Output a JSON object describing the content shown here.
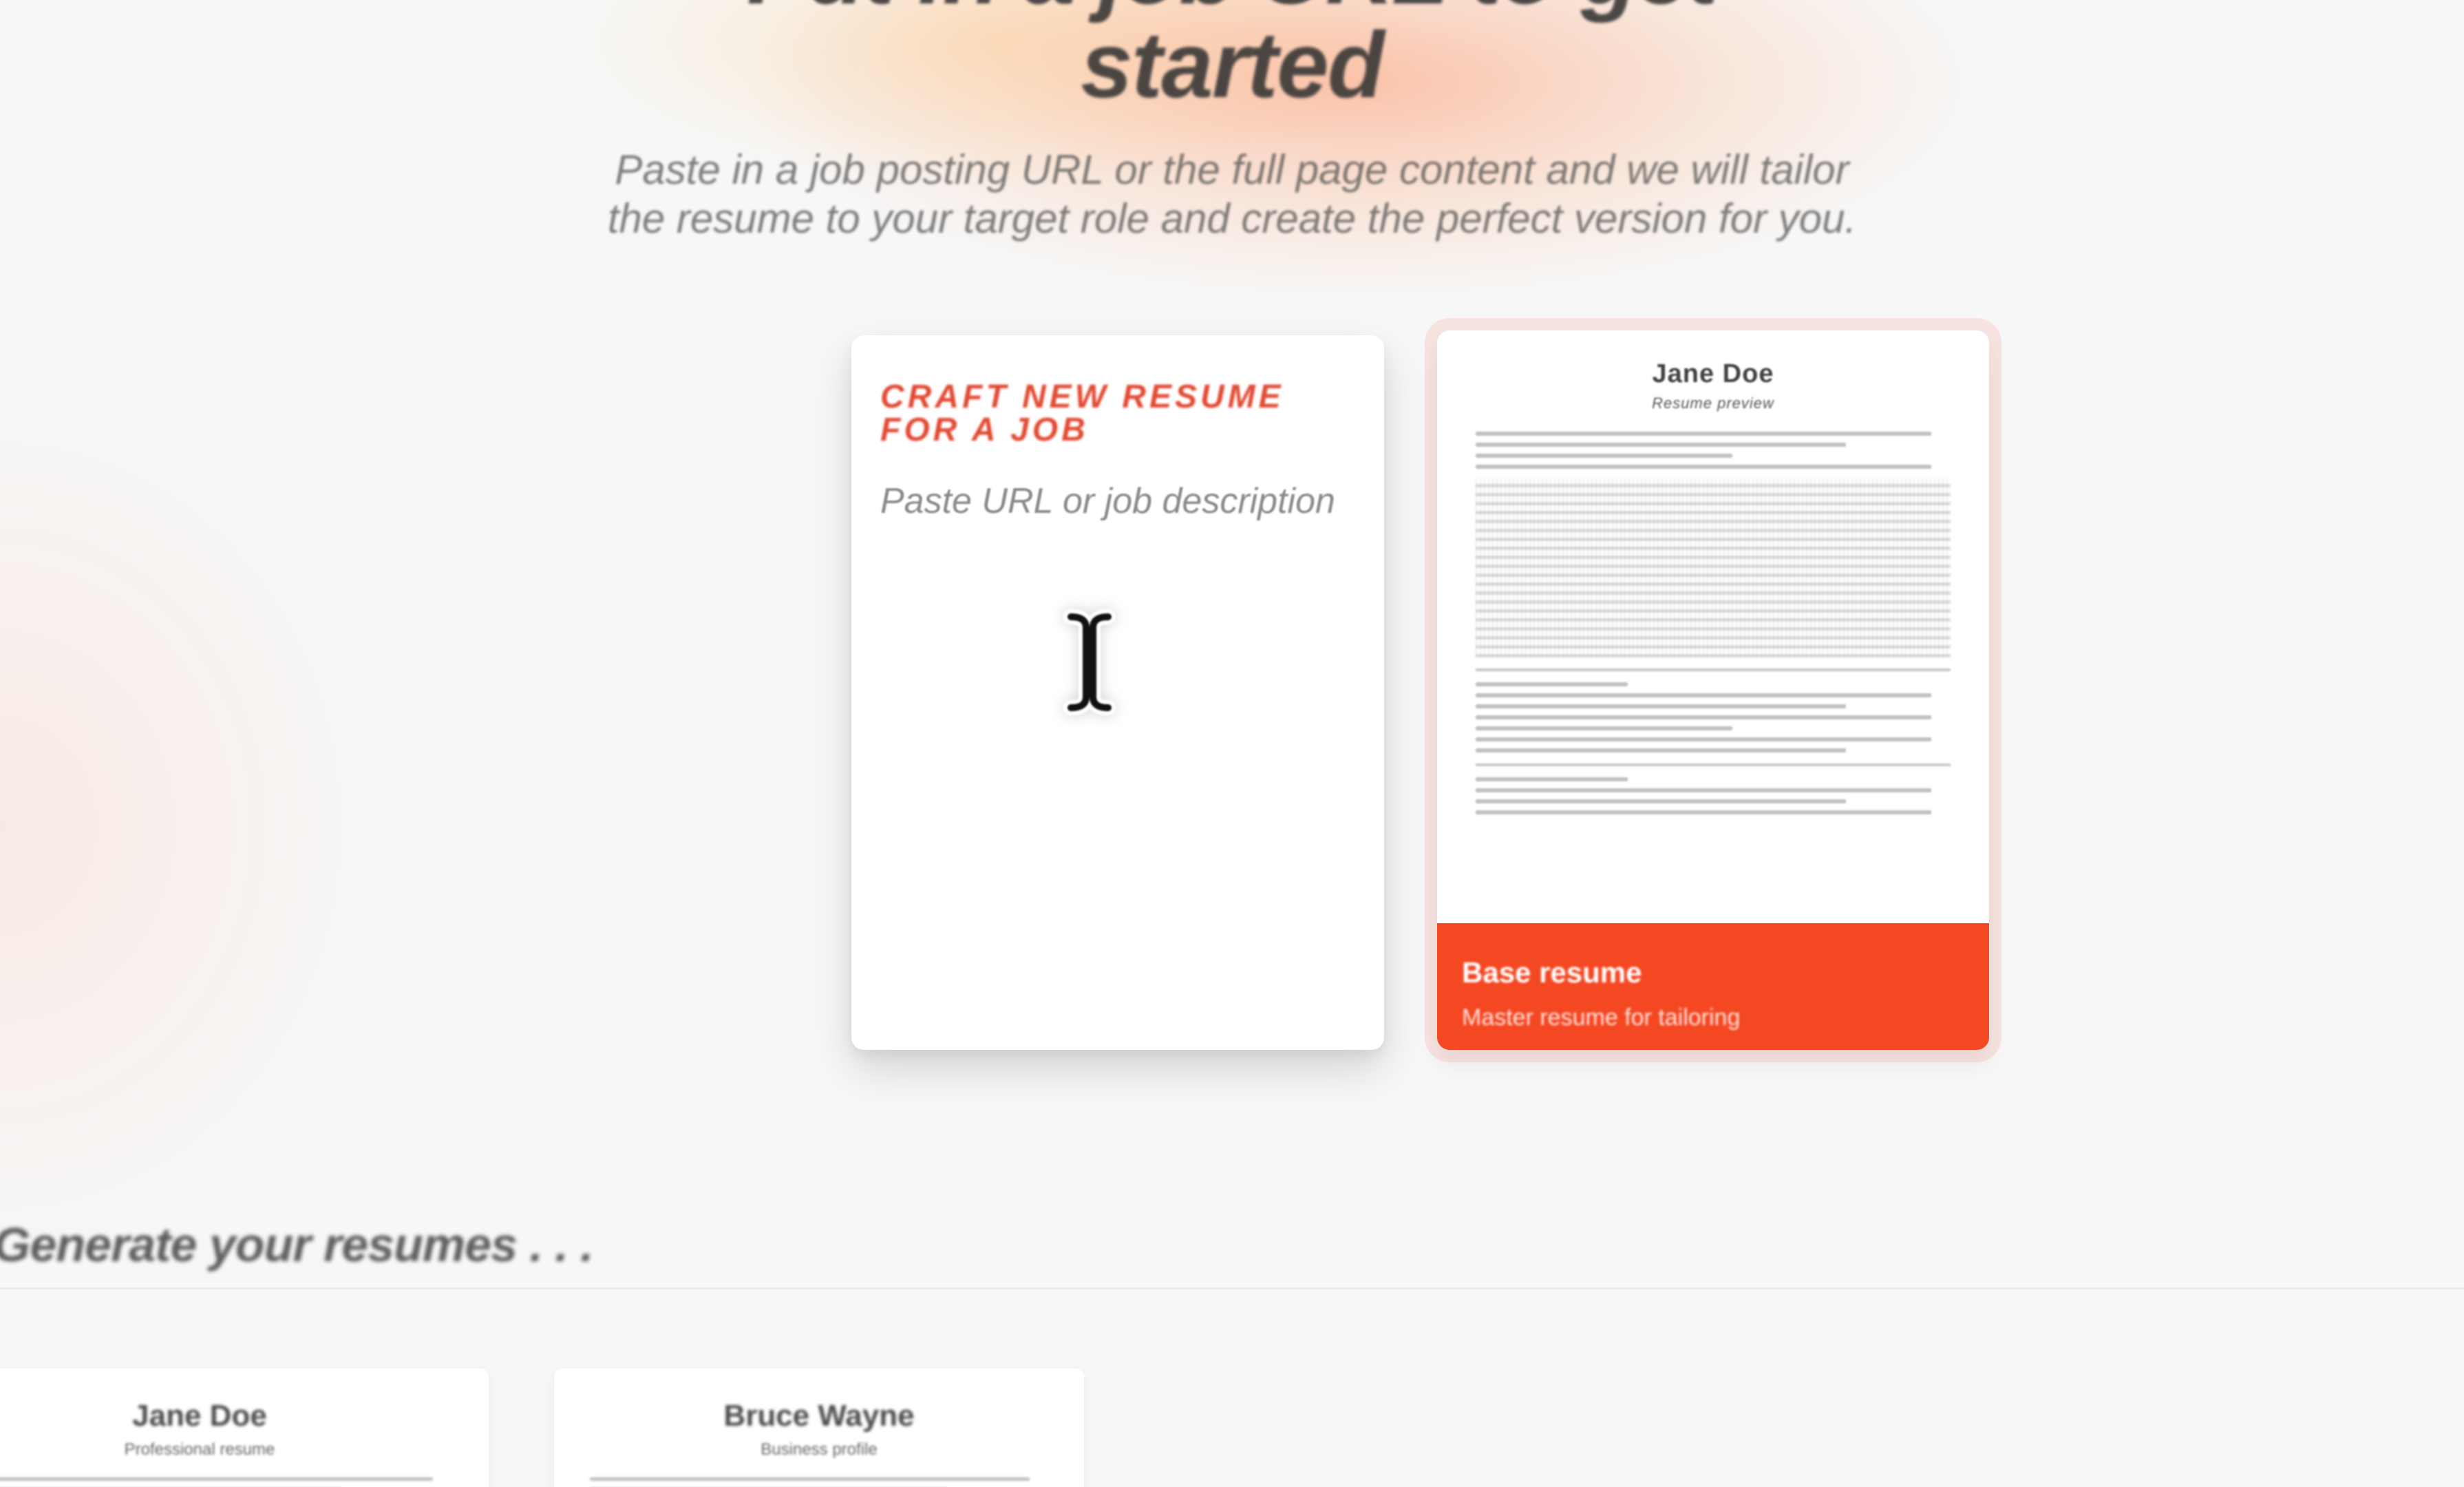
{
  "hero": {
    "title": "Put in a job URL to get started",
    "subtitle": "Paste in a job posting URL or the full page content and we will tailor the resume to your target role and create the perfect version for you."
  },
  "craft_card": {
    "title": "CRAFT NEW RESUME FOR A JOB",
    "placeholder": "Paste URL or job description",
    "cursor_icon": "text-cursor-icon"
  },
  "base_card": {
    "preview": {
      "name": "Jane Doe",
      "meta": "Resume preview"
    },
    "banner_title": "Base resume",
    "banner_subtitle": "Master resume for tailoring"
  },
  "history": {
    "title": "Generate your resumes . . ."
  },
  "recent_resumes": [
    {
      "name": "Jane Doe",
      "meta": "Professional resume"
    },
    {
      "name": "Bruce Wayne",
      "meta": "Business profile"
    }
  ],
  "colors": {
    "accent": "#e24b34",
    "base_banner": "#f44823",
    "background": "#f7f7f7"
  }
}
